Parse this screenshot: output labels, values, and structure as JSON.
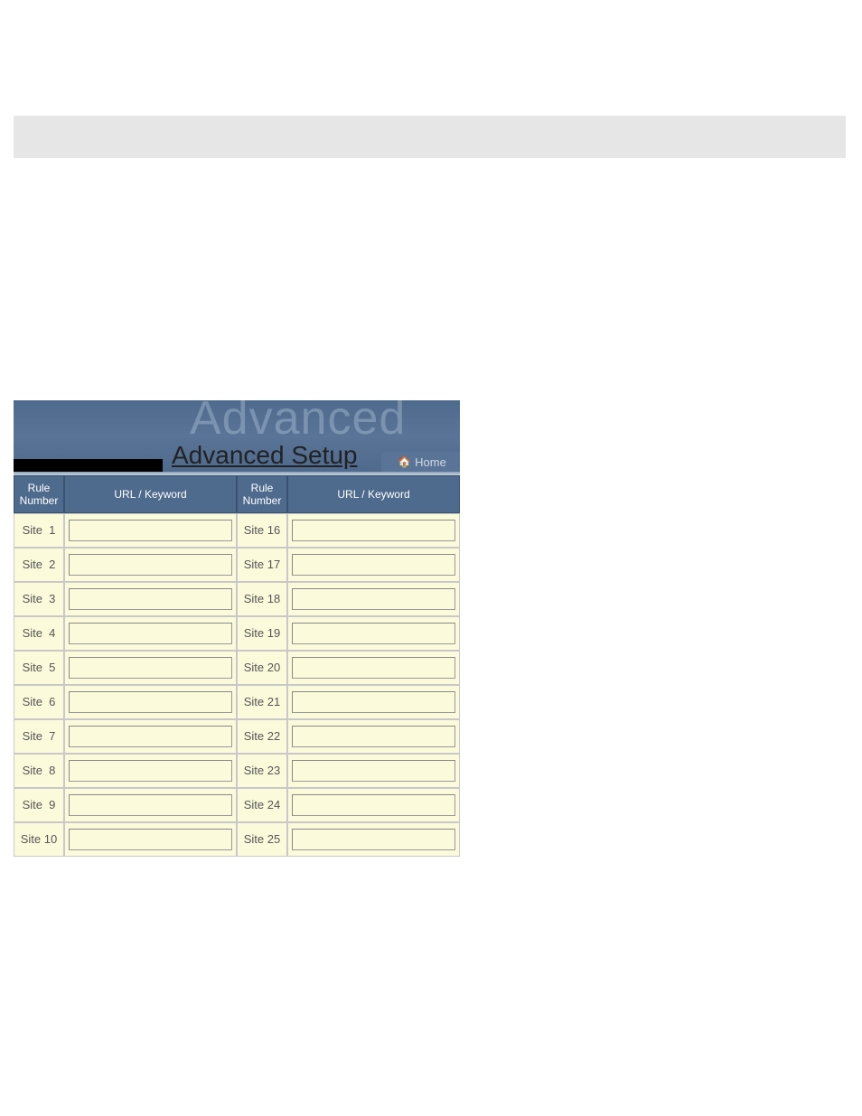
{
  "header": {
    "watermark": "Advanced",
    "title": "Advanced Setup",
    "home_label": "Home"
  },
  "table": {
    "header_rule": "Rule Number",
    "header_url": "URL / Keyword",
    "left": [
      {
        "label": "Site  1",
        "value": ""
      },
      {
        "label": "Site  2",
        "value": ""
      },
      {
        "label": "Site  3",
        "value": ""
      },
      {
        "label": "Site  4",
        "value": ""
      },
      {
        "label": "Site  5",
        "value": ""
      },
      {
        "label": "Site  6",
        "value": ""
      },
      {
        "label": "Site  7",
        "value": ""
      },
      {
        "label": "Site  8",
        "value": ""
      },
      {
        "label": "Site  9",
        "value": ""
      },
      {
        "label": "Site 10",
        "value": ""
      }
    ],
    "right": [
      {
        "label": "Site 16",
        "value": ""
      },
      {
        "label": "Site 17",
        "value": ""
      },
      {
        "label": "Site 18",
        "value": ""
      },
      {
        "label": "Site 19",
        "value": ""
      },
      {
        "label": "Site 20",
        "value": ""
      },
      {
        "label": "Site 21",
        "value": ""
      },
      {
        "label": "Site 22",
        "value": ""
      },
      {
        "label": "Site 23",
        "value": ""
      },
      {
        "label": "Site 24",
        "value": ""
      },
      {
        "label": "Site 25",
        "value": ""
      }
    ]
  }
}
